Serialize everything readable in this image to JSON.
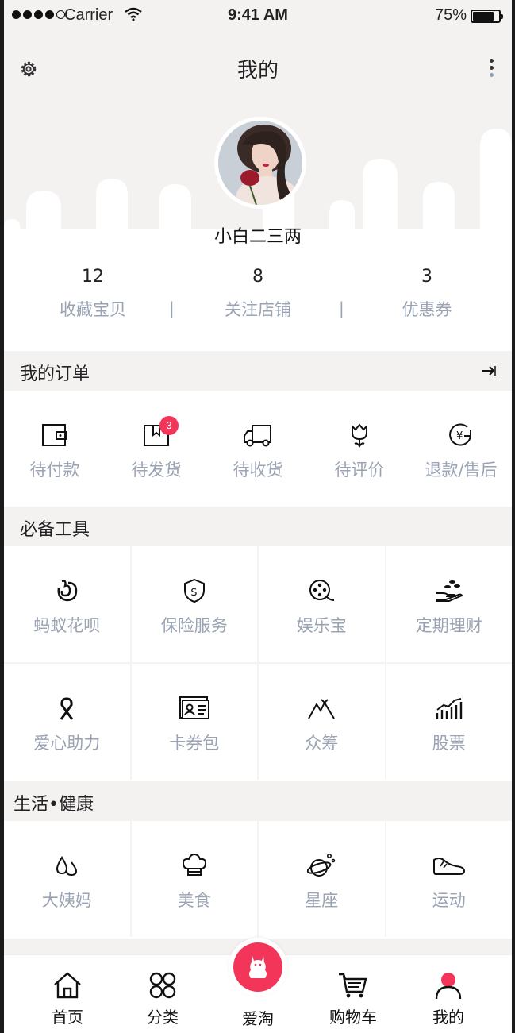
{
  "status_bar": {
    "carrier": "Carrier",
    "time": "9:41 AM",
    "battery": "75%",
    "battery_level": 0.75
  },
  "header": {
    "title": "我的",
    "username": "小白二三两",
    "settings_icon": "gear-icon",
    "more_icon": "more-vertical-icon"
  },
  "stats": [
    {
      "num": "12",
      "label": "收藏宝贝"
    },
    {
      "num": "8",
      "label": "关注店铺"
    },
    {
      "num": "3",
      "label": "优惠券"
    }
  ],
  "stat_separator": "|",
  "orders": {
    "title": "我的订单",
    "arrow_icon": "arrow-right-icon",
    "items": [
      {
        "label": "待付款",
        "icon": "wallet-icon"
      },
      {
        "label": "待发货",
        "icon": "package-icon",
        "badge": "3"
      },
      {
        "label": "待收货",
        "icon": "truck-icon"
      },
      {
        "label": "待评价",
        "icon": "flower-icon"
      },
      {
        "label": "退款/售后",
        "icon": "refund-icon"
      }
    ]
  },
  "tools": {
    "title": "必备工具",
    "items": [
      {
        "label": "蚂蚁花呗",
        "icon": "huabei-icon"
      },
      {
        "label": "保险服务",
        "icon": "shield-dollar-icon"
      },
      {
        "label": "娱乐宝",
        "icon": "film-reel-icon"
      },
      {
        "label": "定期理财",
        "icon": "coins-hand-icon"
      },
      {
        "label": "爱心助力",
        "icon": "ribbon-icon"
      },
      {
        "label": "卡券包",
        "icon": "card-icon"
      },
      {
        "label": "众筹",
        "icon": "mountain-icon"
      },
      {
        "label": "股票",
        "icon": "stock-chart-icon"
      }
    ]
  },
  "life": {
    "title": "生活•健康",
    "items": [
      {
        "label": "大姨妈",
        "icon": "drops-icon"
      },
      {
        "label": "美食",
        "icon": "chef-hat-icon"
      },
      {
        "label": "星座",
        "icon": "planet-icon"
      },
      {
        "label": "运动",
        "icon": "shoe-icon"
      }
    ]
  },
  "tabbar": [
    {
      "label": "首页",
      "icon": "home-icon"
    },
    {
      "label": "分类",
      "icon": "grid-icon"
    },
    {
      "label": "爱淘",
      "icon": "cat-icon"
    },
    {
      "label": "购物车",
      "icon": "cart-icon"
    },
    {
      "label": "我的",
      "icon": "user-icon"
    }
  ],
  "colors": {
    "accent": "#f3355a",
    "muted": "#9aa3b3",
    "bg_gray": "#f4f1f1",
    "divider": "#f5f2f1"
  }
}
